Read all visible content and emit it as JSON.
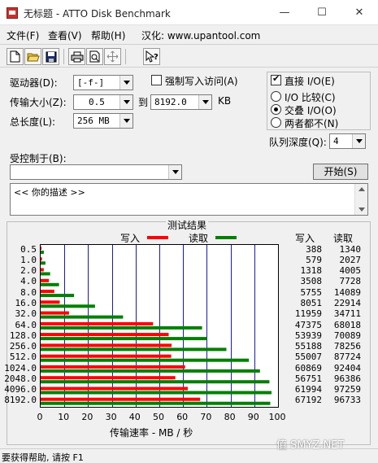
{
  "window": {
    "title": "无标题 - ATTO Disk Benchmark",
    "minimize": "—",
    "maximize": "☐",
    "close": "✕"
  },
  "menu": [
    "文件(F)",
    "查看(V)",
    "帮助(H)",
    "汉化: www.upantool.com"
  ],
  "toolbar": [
    "new-file-icon",
    "open-folder-icon",
    "save-icon",
    "print-icon",
    "print-preview-icon",
    "move-icon",
    "help-cursor-icon"
  ],
  "form": {
    "drive_label": "驱动器(D):",
    "drive_value": "[-f-]",
    "force_write_label": "强制写入访问(A)",
    "force_write_checked": false,
    "transfer_label": "传输大小(Z):",
    "transfer_from": "0.5",
    "transfer_to_word": "到",
    "transfer_to": "8192.0",
    "transfer_unit": "KB",
    "length_label": "总长度(L):",
    "length_value": "256 MB",
    "direct_io_label": "直接 I/O(E)",
    "direct_io_checked": true,
    "io_options": [
      {
        "label": "I/O 比较(C)",
        "selected": false
      },
      {
        "label": "交叠 I/O(O)",
        "selected": true
      },
      {
        "label": "两者都不(N)",
        "selected": false
      }
    ],
    "queue_label": "队列深度(Q):",
    "queue_value": "4",
    "controlled_label": "受控制于(B):",
    "controlled_value": "",
    "start_button": "开始(S)",
    "description": "<<   你的描述   >>"
  },
  "results": {
    "title": "测试结果",
    "write_legend": "写入",
    "read_legend": "读取",
    "write_color": "#ff0000",
    "read_color": "#008000",
    "col_write": "写入",
    "col_read": "读取",
    "x_axis_label": "传输速率 - MB / 秒",
    "x_ticks": [
      "0",
      "10",
      "20",
      "30",
      "40",
      "50",
      "60",
      "70",
      "80",
      "90",
      "100"
    ]
  },
  "chart_data": {
    "type": "bar",
    "orientation": "horizontal",
    "categories": [
      "0.5",
      "1.0",
      "2.0",
      "4.0",
      "8.0",
      "16.0",
      "32.0",
      "64.0",
      "128.0",
      "256.0",
      "512.0",
      "1024.0",
      "2048.0",
      "4096.0",
      "8192.0"
    ],
    "series": [
      {
        "name": "写入",
        "values": [
          388,
          579,
          1318,
          3508,
          5755,
          8051,
          11959,
          47375,
          53939,
          55188,
          55007,
          60869,
          56751,
          61994,
          67192
        ]
      },
      {
        "name": "读取",
        "values": [
          1340,
          2027,
          4005,
          7728,
          14089,
          22914,
          34711,
          68018,
          70089,
          78256,
          87724,
          92404,
          96386,
          97259,
          96733
        ]
      }
    ],
    "xlabel": "传输速率 - MB / 秒",
    "xlim": [
      0,
      100
    ],
    "grid": true
  },
  "status": "要获得帮助, 请按 F1",
  "watermark": "值 SMYZ.NET"
}
